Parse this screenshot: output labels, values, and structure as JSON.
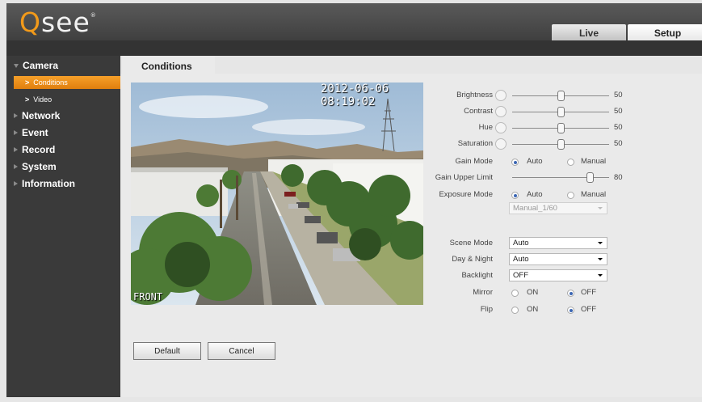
{
  "brand": {
    "logo_q": "Q",
    "logo_rest": "see",
    "trademark": "®"
  },
  "top_tabs": {
    "live": "Live",
    "setup": "Setup"
  },
  "sidebar": {
    "camera": "Camera",
    "conditions": "Conditions",
    "video": "Video",
    "network": "Network",
    "event": "Event",
    "record": "Record",
    "system": "System",
    "information": "Information"
  },
  "page_tab": "Conditions",
  "video": {
    "timestamp": "2012-06-06 08:19:02",
    "channel_name": "FRONT"
  },
  "settings": {
    "brightness": {
      "label": "Brightness",
      "value": "50",
      "level": 0.5
    },
    "contrast": {
      "label": "Contrast",
      "value": "50",
      "level": 0.5
    },
    "hue": {
      "label": "Hue",
      "value": "50",
      "level": 0.5
    },
    "saturation": {
      "label": "Saturation",
      "value": "50",
      "level": 0.5
    },
    "gain_mode": {
      "label": "Gain Mode",
      "auto": "Auto",
      "manual": "Manual",
      "selected": "Auto"
    },
    "gain_upper_limit": {
      "label": "Gain Upper Limit",
      "value": "80",
      "level": 0.8
    },
    "exposure_mode": {
      "label": "Exposure Mode",
      "auto": "Auto",
      "manual": "Manual",
      "selected": "Auto",
      "shutter": "Manual_1/60"
    },
    "scene_mode": {
      "label": "Scene Mode",
      "value": "Auto"
    },
    "day_night": {
      "label": "Day & Night",
      "value": "Auto"
    },
    "backlight": {
      "label": "Backlight",
      "value": "OFF"
    },
    "mirror": {
      "label": "Mirror",
      "on": "ON",
      "off": "OFF",
      "selected": "OFF"
    },
    "flip": {
      "label": "Flip",
      "on": "ON",
      "off": "OFF",
      "selected": "OFF"
    }
  },
  "buttons": {
    "default": "Default",
    "cancel": "Cancel"
  },
  "colors": {
    "accent": "#f29a1a",
    "sidebar_bg": "#3a3a3a",
    "topbar_bg": "#4a4a4a",
    "radio_selected": "#3b66b3"
  }
}
